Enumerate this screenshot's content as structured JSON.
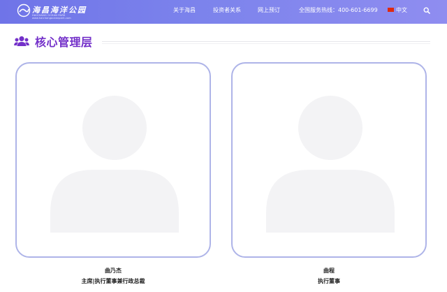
{
  "header": {
    "logo_text": "海昌海洋公园",
    "logo_sub": "HAICHANG OCEAN PARK",
    "logo_sub2": "www.haichangoceanpark.com",
    "nav": [
      {
        "label": "关于海昌"
      },
      {
        "label": "投资者关系"
      },
      {
        "label": "网上预订"
      }
    ],
    "hotline": "全国服务热线：400-601-6699",
    "language": "中文"
  },
  "section": {
    "title": "核心管理层",
    "icon": "users-icon"
  },
  "members": [
    {
      "name": "曲乃杰",
      "title": "主席|执行董事兼行政总裁"
    },
    {
      "name": "曲程",
      "title": "执行董事"
    }
  ],
  "colors": {
    "header_start": "#6f74e8",
    "header_end": "#8f8df0",
    "title": "#7330c9",
    "card_border": "#aeb4e8",
    "placeholder": "#f3f3f5"
  }
}
